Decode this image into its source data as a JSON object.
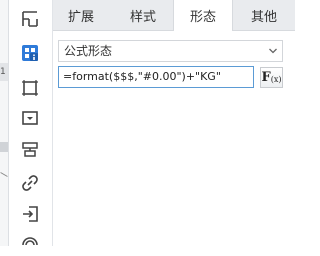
{
  "tabs": [
    {
      "label": "扩展",
      "active": false
    },
    {
      "label": "样式",
      "active": false
    },
    {
      "label": "形态",
      "active": true
    },
    {
      "label": "其他",
      "active": false
    }
  ],
  "format": {
    "selected": "公式形态",
    "formula": "=format($$$,\"#0.00\")+\"KG\"",
    "fx_label": "F",
    "fx_sub": "(x)"
  },
  "sidebar": {
    "icons": [
      "cell-element-icon",
      "cell-attribute-icon",
      "float-element-icon",
      "widget-settings-icon",
      "condition-attribute-icon",
      "hyperlink-icon",
      "data-entry-icon",
      "more-icon"
    ],
    "active": "cell-attribute-icon"
  },
  "edge": {
    "marker": "1"
  },
  "colors": {
    "accent": "#2f7bd9",
    "tabbar_bg": "#e9ebee",
    "input_border_active": "#5b9bd5"
  }
}
